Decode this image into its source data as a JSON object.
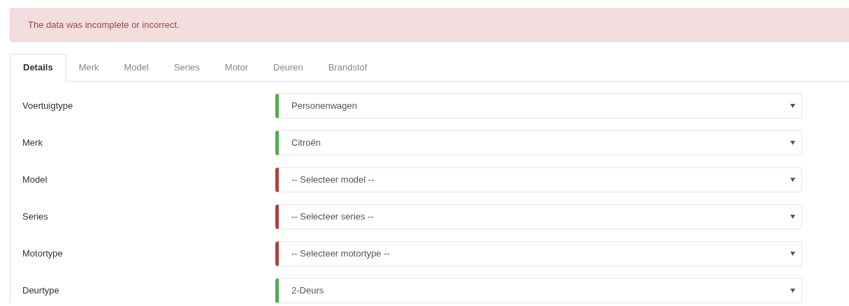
{
  "alert": {
    "message": "The data was incomplete or incorrect."
  },
  "tabs": [
    {
      "label": "Details",
      "selected": true
    },
    {
      "label": "Merk",
      "selected": false
    },
    {
      "label": "Model",
      "selected": false
    },
    {
      "label": "Series",
      "selected": false
    },
    {
      "label": "Motor",
      "selected": false
    },
    {
      "label": "Deuren",
      "selected": false
    },
    {
      "label": "Brandstof",
      "selected": false
    }
  ],
  "fields": [
    {
      "label": "Voertuigtype",
      "value": "Personenwagen",
      "valid": true
    },
    {
      "label": "Merk",
      "value": "Citroën",
      "valid": true
    },
    {
      "label": "Model",
      "value": "-- Selecteer model --",
      "valid": false
    },
    {
      "label": "Series",
      "value": "-- Selecteer series --",
      "valid": false
    },
    {
      "label": "Motortype",
      "value": "-- Selecteer motortype --",
      "valid": false
    },
    {
      "label": "Deurtype",
      "value": "2-Deurs",
      "valid": true
    }
  ]
}
